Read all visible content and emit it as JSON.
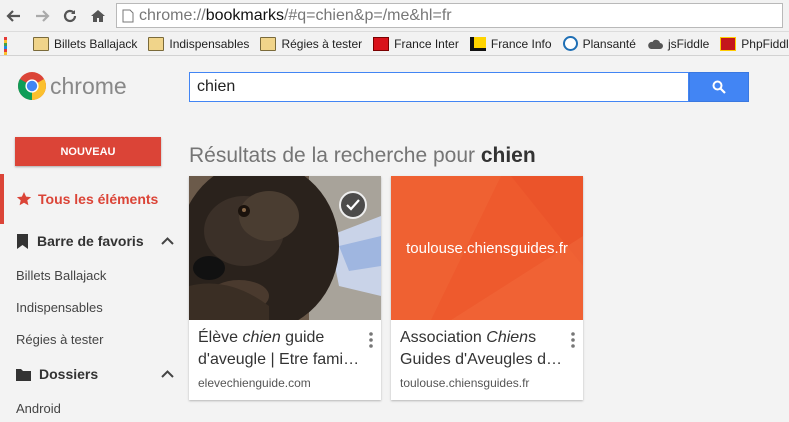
{
  "browser": {
    "url_prefix": "chrome://",
    "url_host": "bookmarks",
    "url_rest": "/#q=chien&p=/me&hl=fr"
  },
  "bookmarks_bar": [
    {
      "label": "Billets Ballajack",
      "icon": "folder-icon"
    },
    {
      "label": "Indispensables",
      "icon": "folder-icon"
    },
    {
      "label": "Régies à tester",
      "icon": "folder-icon"
    },
    {
      "label": "France Inter",
      "icon": "france-inter-icon"
    },
    {
      "label": "France Info",
      "icon": "france-info-icon"
    },
    {
      "label": "Plansanté",
      "icon": "plansante-icon"
    },
    {
      "label": "jsFiddle",
      "icon": "cloud-icon"
    },
    {
      "label": "PhpFiddle",
      "icon": "phpfiddle-icon"
    }
  ],
  "logo_text": "chrome",
  "search": {
    "value": "chien"
  },
  "sidebar": {
    "new_button": "NOUVEAU",
    "all_items": "Tous les éléments",
    "favorites_bar": "Barre de favoris",
    "favorites": [
      "Billets Ballajack",
      "Indispensables",
      "Régies à tester"
    ],
    "folders": "Dossiers",
    "folder_items": [
      "Android"
    ]
  },
  "results": {
    "title_prefix": "Résultats de la recherche pour ",
    "query": "chien"
  },
  "cards": [
    {
      "title_pre": "Élève ",
      "title_em": "chien",
      "title_post": " guide",
      "title_line2": "d'aveugle | Etre famille d'accueil",
      "domain": "elevechienguide.com"
    },
    {
      "title_pre": "Association ",
      "title_em": "Chien",
      "title_post": "s",
      "title_line2": "Guides d'Aveugles de Toulouse",
      "domain": "toulouse.chiensguides.fr",
      "thumb_text": "toulouse.chiensguides.fr"
    }
  ],
  "colors": {
    "accent_red": "#db4437",
    "search_blue": "#4285f4",
    "thumb_orange": "#ee5a2d"
  }
}
